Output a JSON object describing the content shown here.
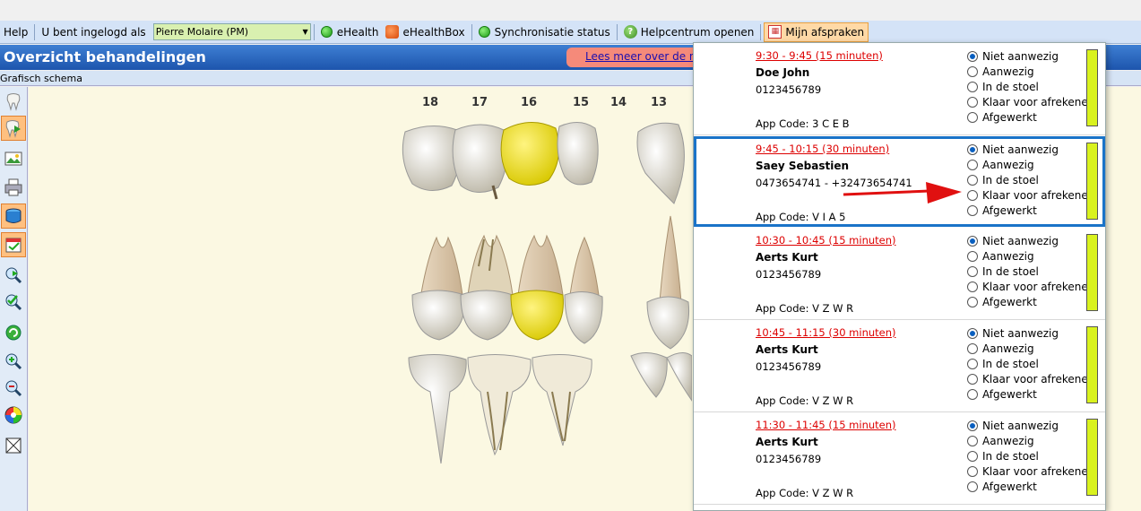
{
  "toolbar": {
    "help": "Help",
    "logged_in_label": "U bent ingelogd als",
    "user": "Pierre Molaire (PM)",
    "ehealth": "eHealth",
    "ehealthbox": "eHealthBox",
    "sync": "Synchronisatie status",
    "helpcenter": "Helpcentrum openen",
    "appointments": "Mijn afspraken"
  },
  "header": {
    "title": "Overzicht behandelingen",
    "banner": "Lees meer over de n"
  },
  "subbar": {
    "label": "Grafisch schema"
  },
  "teeth_numbers": [
    "18",
    "17",
    "16",
    "15",
    "14",
    "13"
  ],
  "status_options": [
    "Niet aanwezig",
    "Aanwezig",
    "In de stoel",
    "Klaar voor afrekenen",
    "Afgewerkt"
  ],
  "appointments": [
    {
      "time": "9:30 - 9:45 (15 minuten)",
      "name": "Doe John",
      "phone": "0123456789",
      "code": "App Code:  3 C E B",
      "selected": 0
    },
    {
      "time": "9:45 - 10:15 (30 minuten)",
      "name": "Saey Sebastien",
      "phone": "0473654741 - +32473654741",
      "code": "App Code:  V I A 5",
      "selected": 0
    },
    {
      "time": "10:30 - 10:45 (15 minuten)",
      "name": "Aerts Kurt",
      "phone": "0123456789",
      "code": "App Code:  V Z W R",
      "selected": 0
    },
    {
      "time": "10:45 - 11:15 (30 minuten)",
      "name": "Aerts Kurt",
      "phone": "0123456789",
      "code": "App Code:  V Z W R",
      "selected": 0
    },
    {
      "time": "11:30 - 11:45 (15 minuten)",
      "name": "Aerts Kurt",
      "phone": "0123456789",
      "code": "App Code:  V Z W R",
      "selected": 0
    }
  ],
  "colors": {
    "status_bar": "#d9f21e",
    "time_text": "#dd0000",
    "selected_border": "#1a73c8"
  }
}
